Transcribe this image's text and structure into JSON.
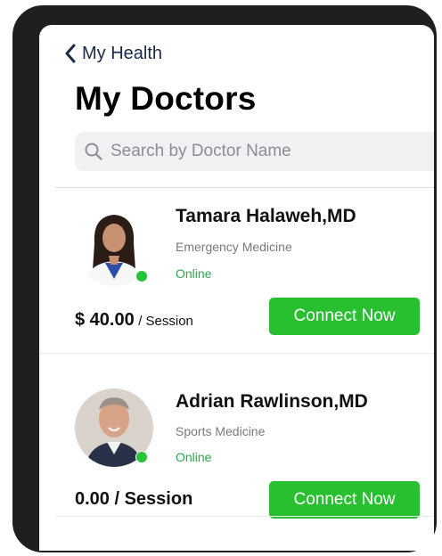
{
  "nav": {
    "back_label": "My Health"
  },
  "page": {
    "title": "My Doctors"
  },
  "search": {
    "placeholder": "Search by Doctor Name"
  },
  "doctors": [
    {
      "name": "Tamara Halaweh,MD",
      "specialty": "Emergency Medicine",
      "status": "Online",
      "price_amount": "$ 40.00",
      "price_unit": "/ Session",
      "cta": "Connect Now"
    },
    {
      "name": "Adrian Rawlinson,MD",
      "specialty": "Sports Medicine",
      "status": "Online",
      "price_text": "0.00 / Session",
      "cta": "Connect Now"
    }
  ],
  "colors": {
    "accent_green": "#28c030",
    "online_green": "#2ea84a",
    "nav_text": "#1a2a47",
    "device_frame": "#1f1f1f"
  },
  "icons": [
    "chevron-left-icon",
    "search-icon",
    "online-status-dot"
  ]
}
